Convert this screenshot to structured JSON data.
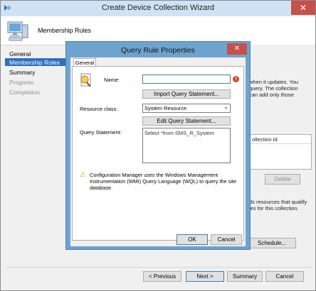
{
  "wizard": {
    "title": "Create Device Collection Wizard",
    "close_glyph": "✕",
    "header_title": "Membership Rules",
    "header_icon": "computer-icon",
    "nav": [
      {
        "label": "General",
        "state": "done"
      },
      {
        "label": "Membership Rules",
        "state": "active"
      },
      {
        "label": "Summary",
        "state": "done"
      },
      {
        "label": "Progress",
        "state": "disabled"
      },
      {
        "label": "Completion",
        "state": "disabled"
      }
    ],
    "background_fragments": {
      "updates_line1": "when it updates. You",
      "updates_line2": "query. The collection",
      "updates_line3": "can add only those",
      "collection_id_header": "ollection Id",
      "delete_button": "Delete",
      "qualify_line1": "ds resources that qualify",
      "qualify_line2": "ies for this collection.",
      "schedule_button": "Schedule..."
    },
    "footer": {
      "previous": "< Previous",
      "next": "Next >",
      "summary": "Summary",
      "cancel": "Cancel"
    }
  },
  "dialog": {
    "title": "Query Rule Properties",
    "close_glyph": "✕",
    "tab": "General",
    "name_label": "Name:",
    "name_value": "",
    "error_glyph": "!",
    "import_button": "Import Query Statement...",
    "resource_class_label": "Resource class:",
    "resource_class_value": "System Resource",
    "dropdown_glyph": "⌄",
    "edit_button": "Edit Query Statement...",
    "query_statement_label": "Query Statement:",
    "query_statement_value": "Select *from SMS_R_System",
    "warning_glyph": "⚠",
    "warning_text": "Configuration Manager uses the Windows Management Instrumentation (WMI) Query Language (WQL) to query the site database.",
    "ok": "OK",
    "cancel": "Cancel"
  },
  "colors": {
    "nav_active": "#2f6ebf",
    "titlebar": "#cfe3f4",
    "modal_frame": "#6fa3cf",
    "close_button": "#c7504b"
  }
}
